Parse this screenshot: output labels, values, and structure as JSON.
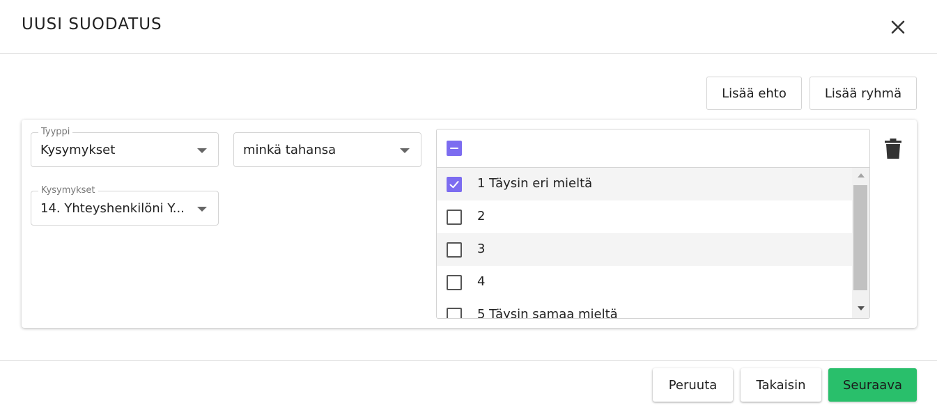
{
  "dialog": {
    "title": "UUSI SUODATUS",
    "close_icon": "close-icon"
  },
  "toolbar": {
    "add_condition_label": "Lisää ehto",
    "add_group_label": "Lisää ryhmä"
  },
  "condition": {
    "type_field": {
      "label": "Tyyppi",
      "value": "Kysymykset"
    },
    "operator_field": {
      "value": "minkä tahansa"
    },
    "question_field": {
      "label": "Kysymykset",
      "value": "14. Yhteyshenkilöni Y..."
    },
    "select_all_state": "indeterminate",
    "options": [
      {
        "label": "1 Täysin eri mieltä",
        "checked": true
      },
      {
        "label": "2",
        "checked": false
      },
      {
        "label": "3",
        "checked": false
      },
      {
        "label": "4",
        "checked": false
      },
      {
        "label": "5 Täysin samaa mieltä",
        "checked": false
      }
    ],
    "delete_icon": "trash-icon"
  },
  "footer": {
    "cancel_label": "Peruuta",
    "back_label": "Takaisin",
    "next_label": "Seuraava"
  },
  "colors": {
    "accent_checkbox": "#7c6cf0",
    "primary_button": "#29bf6b"
  }
}
